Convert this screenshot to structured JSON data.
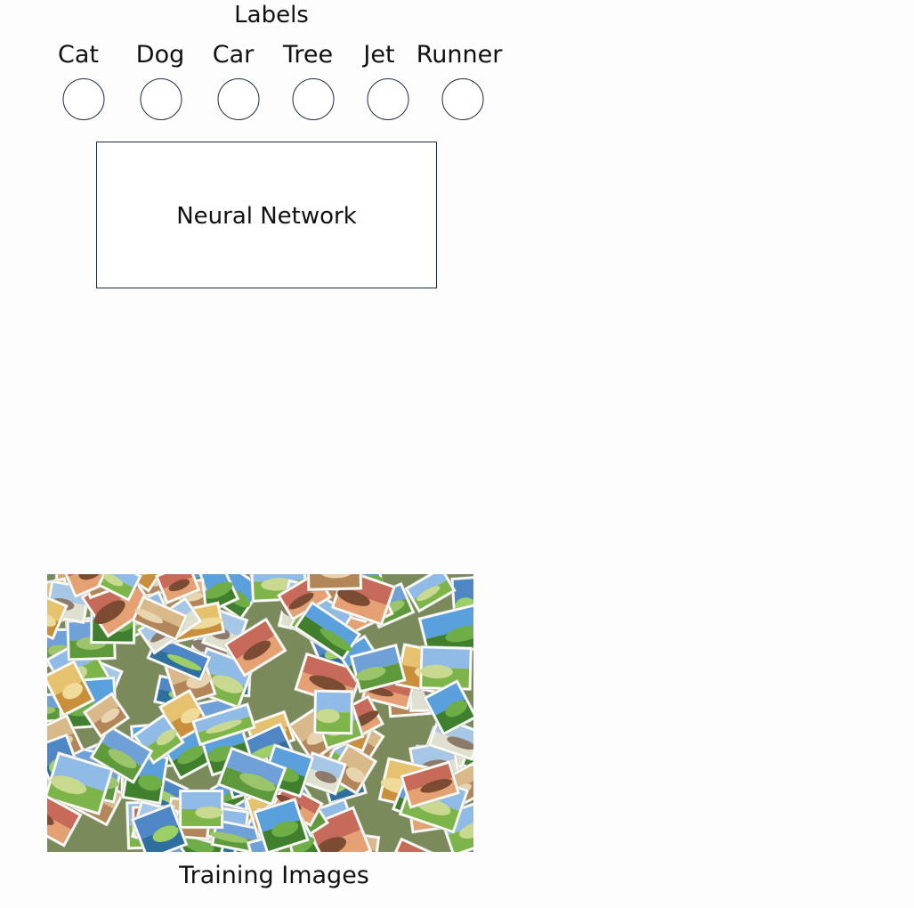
{
  "diagram": {
    "labels_title": "Labels",
    "classes": [
      "Cat",
      "Dog",
      "Car",
      "Tree",
      "Jet",
      "Runner"
    ],
    "network_label": "Neural Network",
    "images_caption": "Training Images"
  },
  "colors": {
    "outline": "#1f2a44",
    "background": "#fdfdfd",
    "text": "#111111"
  },
  "icons": {
    "training_images": "photo-collage"
  }
}
